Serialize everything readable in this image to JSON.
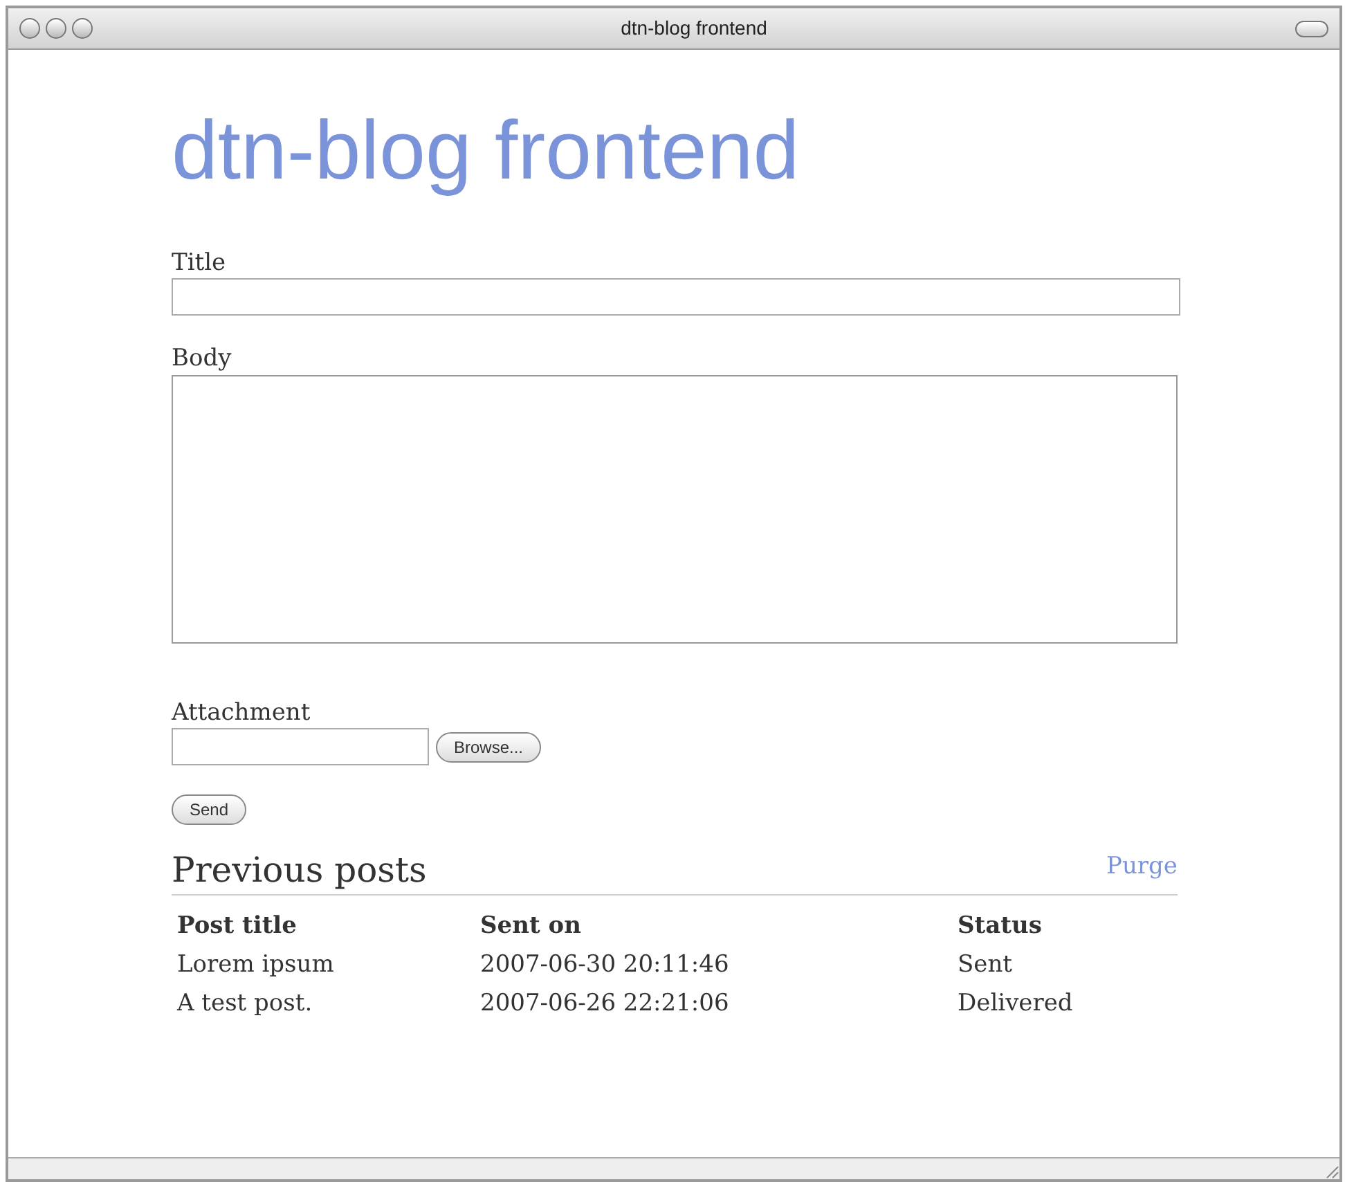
{
  "window": {
    "title": "dtn-blog frontend"
  },
  "heading": "dtn-blog frontend",
  "form": {
    "title_label": "Title",
    "body_label": "Body",
    "attachment_label": "Attachment",
    "browse_button": "Browse...",
    "send_button": "Send"
  },
  "previous_posts": {
    "heading": "Previous posts",
    "purge_link": "Purge",
    "columns": [
      "Post title",
      "Sent on",
      "Status"
    ],
    "rows": [
      [
        "Lorem ipsum",
        "2007-06-30 20:11:46",
        "Sent"
      ],
      [
        "A test post.",
        "2007-06-26 22:21:06",
        "Delivered"
      ]
    ]
  }
}
